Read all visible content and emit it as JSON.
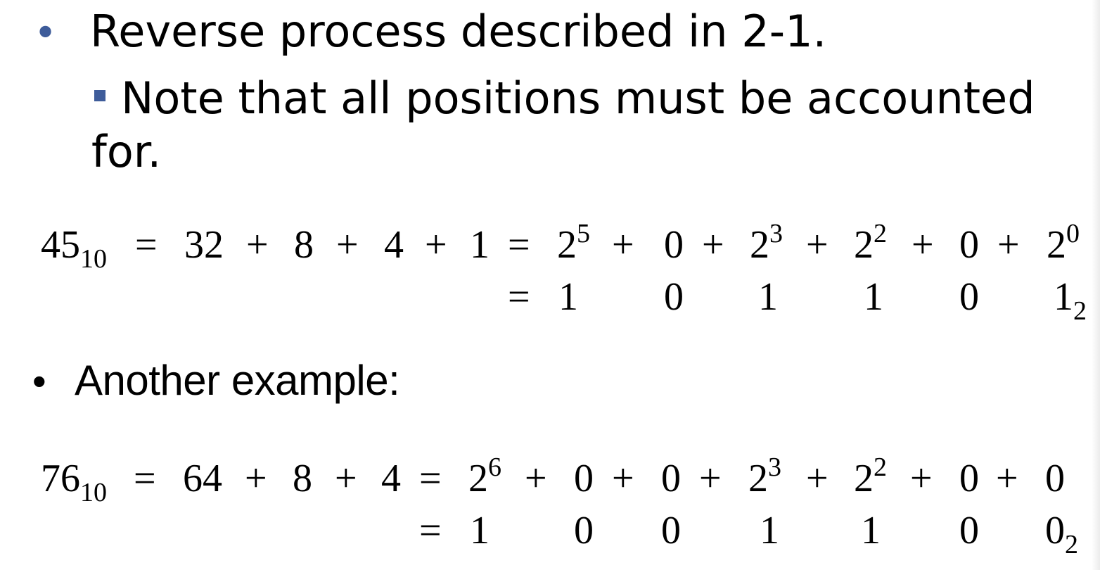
{
  "bullets": {
    "b1": "Reverse process described in 2-1.",
    "b1_sub": "Note that all positions must be accounted for.",
    "b2": "Another example:"
  },
  "eq1": {
    "lhs_num": "45",
    "lhs_base": "10",
    "eq_sign": "=",
    "plus": "+",
    "sum_terms": [
      "32",
      "8",
      "4",
      "1"
    ],
    "pow_terms": [
      {
        "base": "2",
        "exp": "5"
      },
      {
        "text": "0"
      },
      {
        "base": "2",
        "exp": "3"
      },
      {
        "base": "2",
        "exp": "2"
      },
      {
        "text": "0"
      },
      {
        "base": "2",
        "exp": "0"
      }
    ],
    "digits": [
      "1",
      "0",
      "1",
      "1",
      "0",
      "1"
    ],
    "result_base": "2"
  },
  "eq2": {
    "lhs_num": "76",
    "lhs_base": "10",
    "eq_sign": "=",
    "plus": "+",
    "sum_terms": [
      "64",
      "8",
      "4"
    ],
    "pow_terms": [
      {
        "base": "2",
        "exp": "6"
      },
      {
        "text": "0"
      },
      {
        "text": "0"
      },
      {
        "base": "2",
        "exp": "3"
      },
      {
        "base": "2",
        "exp": "2"
      },
      {
        "text": "0"
      },
      {
        "text": "0"
      }
    ],
    "digits": [
      "1",
      "0",
      "0",
      "1",
      "1",
      "0",
      "0"
    ],
    "result_base": "2"
  },
  "colors": {
    "bullet_accent": "#3e5c9a",
    "text": "#000000",
    "background": "#ffffff"
  }
}
